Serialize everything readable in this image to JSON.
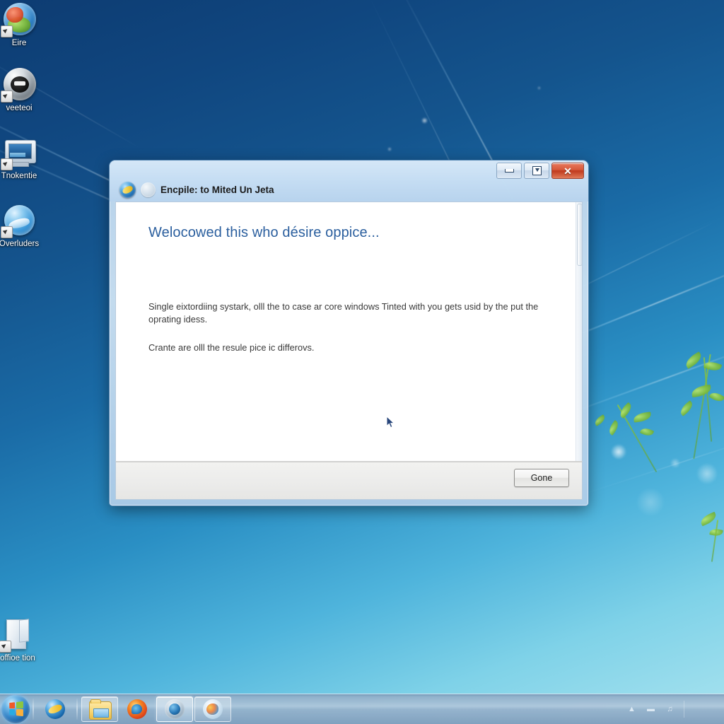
{
  "desktop": {
    "icons": [
      {
        "label": "Eire",
        "icon_name": "globe-world-shortcut-icon"
      },
      {
        "label": "veeteoi",
        "icon_name": "dark-orb-shortcut-icon"
      },
      {
        "label": "Tnokentie",
        "icon_name": "computer-monitor-shortcut-icon"
      },
      {
        "label": "Overluders",
        "icon_name": "blue-sphere-shortcut-icon"
      },
      {
        "label": "offioe tion",
        "icon_name": "document-page-shortcut-icon"
      }
    ]
  },
  "window": {
    "title": "Encpile: to Mited Un Jeta",
    "title_icon": "internet-explorer-icon",
    "back_icon": "back-navigation-icon",
    "controls": {
      "minimize": "–",
      "maximize": "□",
      "close": "✕"
    },
    "content": {
      "heading": "Welocowed this who désire oppice...",
      "paragraphs": [
        "Single eixtordiing systark, olll the to case ar core windows Tinted with you gets usid by the put the oprating idess.",
        "Crante are olll the resule pice ic differovs."
      ]
    },
    "footer": {
      "done_label": "Gone"
    }
  },
  "taskbar": {
    "start_label": "Start",
    "items": [
      {
        "name": "internet-explorer",
        "icon_name": "internet-explorer-icon",
        "state": "pinned"
      },
      {
        "name": "windows-explorer",
        "icon_name": "folder-icon",
        "state": "pinned"
      },
      {
        "name": "firefox",
        "icon_name": "firefox-icon",
        "state": "pinned"
      },
      {
        "name": "media-player",
        "icon_name": "media-player-icon",
        "state": "active"
      },
      {
        "name": "paint-app",
        "icon_name": "paint-palette-icon",
        "state": "pinned"
      }
    ],
    "tray": [
      {
        "name": "show-hidden-icons",
        "icon_name": "chevron-up-icon",
        "glyph": "▲"
      },
      {
        "name": "network",
        "icon_name": "network-icon",
        "glyph": "▬"
      },
      {
        "name": "volume",
        "icon_name": "volume-icon",
        "glyph": "♫"
      }
    ],
    "clock": {
      "time": "",
      "date": ""
    }
  },
  "colors": {
    "wallpaper_top": "#0d3c72",
    "wallpaper_bottom": "#a9e3ef",
    "window_chrome": "#c6def3",
    "heading_blue": "#2b5f9e",
    "close_red": "#c03b1f",
    "taskbar": "#93aec8"
  }
}
